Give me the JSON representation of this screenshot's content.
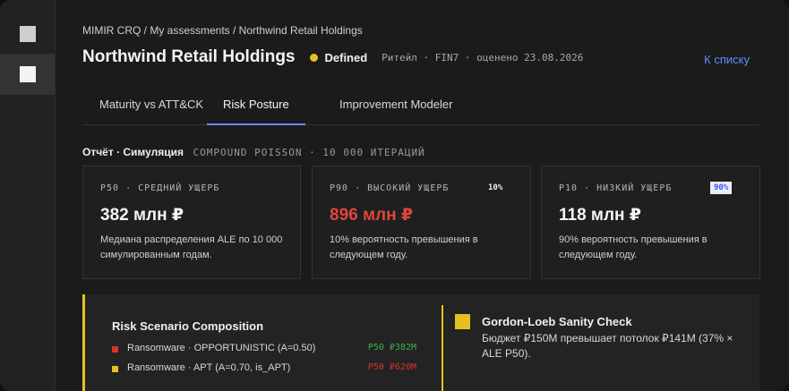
{
  "breadcrumb": "MIMIR CRQ / My assessments / Northwind Retail Holdings",
  "header": {
    "title": "Northwind Retail Holdings",
    "status": "Defined",
    "meta": "Ритейл · FIN7 · оценено 23.08.2026",
    "back_link": "К списку"
  },
  "colors": {
    "accent_yellow": "#e6c021",
    "link_blue": "#5b8dff",
    "danger_red": "#e0453a",
    "ok_green": "#3fae4a",
    "tab_underline": "#6f86ff"
  },
  "tabs": [
    {
      "label": "Maturity vs ATT&CK",
      "active": false
    },
    {
      "label": "Risk Posture",
      "active": true
    },
    {
      "label": "Improvement Modeler",
      "active": false
    }
  ],
  "section": {
    "label": "Отчёт · Симуляция",
    "method": "COMPOUND POISSON · 10 000 ИТЕРАЦИЙ"
  },
  "cards": [
    {
      "label": "P50 · СРЕДНИЙ УЩЕРБ",
      "badge": "",
      "value": "382 млн ₽",
      "desc": "Медиана распределения ALE по 10 000 симулированным годам."
    },
    {
      "label": "P90 · ВЫСОКИЙ УЩЕРБ",
      "badge": "10%",
      "value": "896 млн ₽",
      "desc": "10% вероятность превышения в следующем году."
    },
    {
      "label": "P10 · НИЗКИЙ УЩЕРБ",
      "badge": "90%",
      "value": "118 млн ₽",
      "desc": "90% вероятность превышения в следующем году."
    }
  ],
  "composition": {
    "title": "Risk Scenario Composition",
    "items": [
      {
        "label": "Ransomware · OPPORTUNISTIC (A=0.50)",
        "value": "P50 ₽382M",
        "swatch": "#d8322c",
        "value_color": "#3fae4a"
      },
      {
        "label": "Ransomware · APT (A=0.70, is_APT)",
        "value": "P50 ₽620M",
        "swatch": "#e6c021",
        "value_color": "#d8322c"
      }
    ]
  },
  "gordon_loeb": {
    "title": "Gordon-Loeb Sanity Check",
    "text": "Бюджет ₽150M превышает потолок ₽141M (37% × ALE P50)."
  }
}
